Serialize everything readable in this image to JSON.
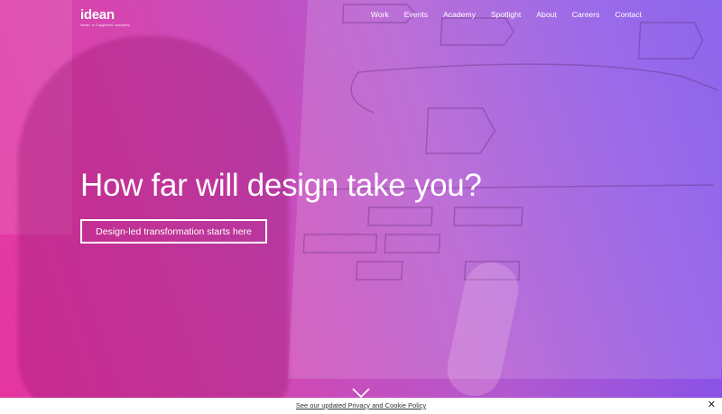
{
  "brand": {
    "logo_text": "idean",
    "logo_subtext": "Idean, a Capgemini company"
  },
  "nav": {
    "items": [
      "Work",
      "Events",
      "Academy",
      "Spotlight",
      "About",
      "Careers",
      "Contact"
    ]
  },
  "hero": {
    "headline": "How far will design take you?",
    "cta_label": "Design-led transformation starts here"
  },
  "cookie_bar": {
    "link_text": "See our updated Privacy and Cookie Policy",
    "close_glyph": "✕"
  },
  "colors": {
    "gradient_start": "#e6359f",
    "gradient_end": "#7a4de8",
    "text": "#ffffff"
  }
}
